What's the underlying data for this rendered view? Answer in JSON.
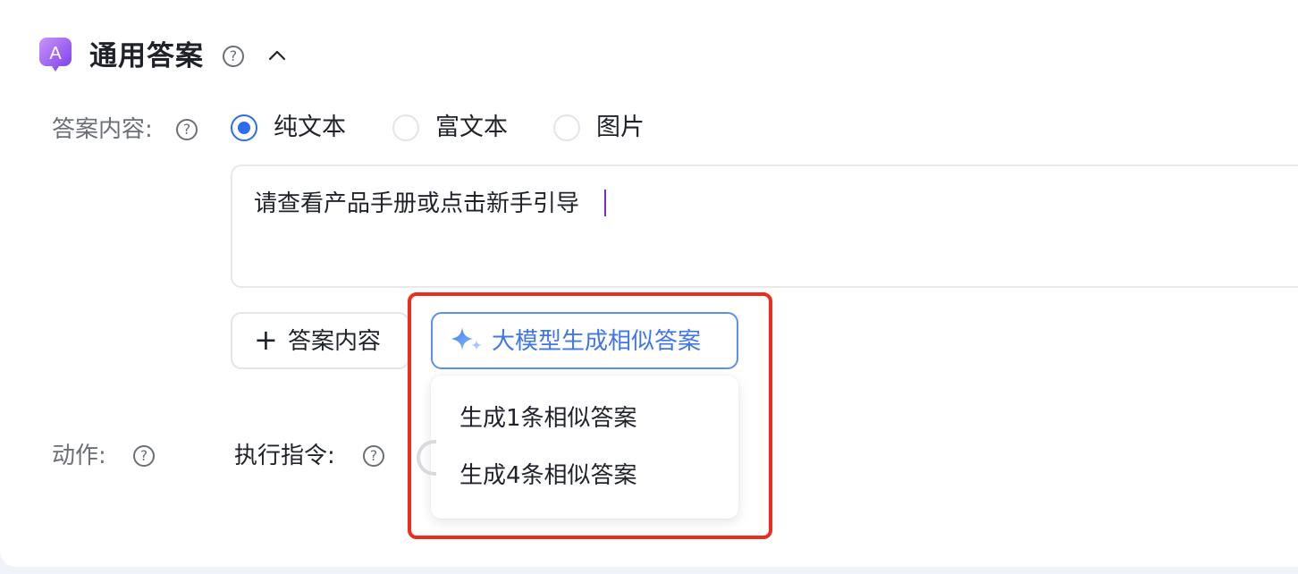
{
  "section": {
    "title": "通用答案",
    "logo_letter": "A",
    "help_glyph": "?",
    "collapse_icon": "chevron-up-icon"
  },
  "answer_content": {
    "label": "答案内容:",
    "radio_options": [
      {
        "label": "纯文本",
        "selected": true
      },
      {
        "label": "富文本",
        "selected": false
      },
      {
        "label": "图片",
        "selected": false
      }
    ],
    "text_value": "请查看产品手册或点击新手引导",
    "add_button": {
      "icon": "plus-icon",
      "glyph": "+",
      "label": "答案内容"
    },
    "ai_button": {
      "icon": "sparkle-icon",
      "label": "大模型生成相似答案"
    },
    "dropdown_items": [
      "生成1条相似答案",
      "生成4条相似答案"
    ]
  },
  "action": {
    "label": "动作:",
    "command_label": "执行指令:"
  },
  "colors": {
    "accent": "#2d6cf0",
    "ai_text": "#3f76e8",
    "highlight_border": "#ec2c1c",
    "logo_gradient_start": "#c58cf6",
    "logo_gradient_end": "#7f3ff0"
  }
}
